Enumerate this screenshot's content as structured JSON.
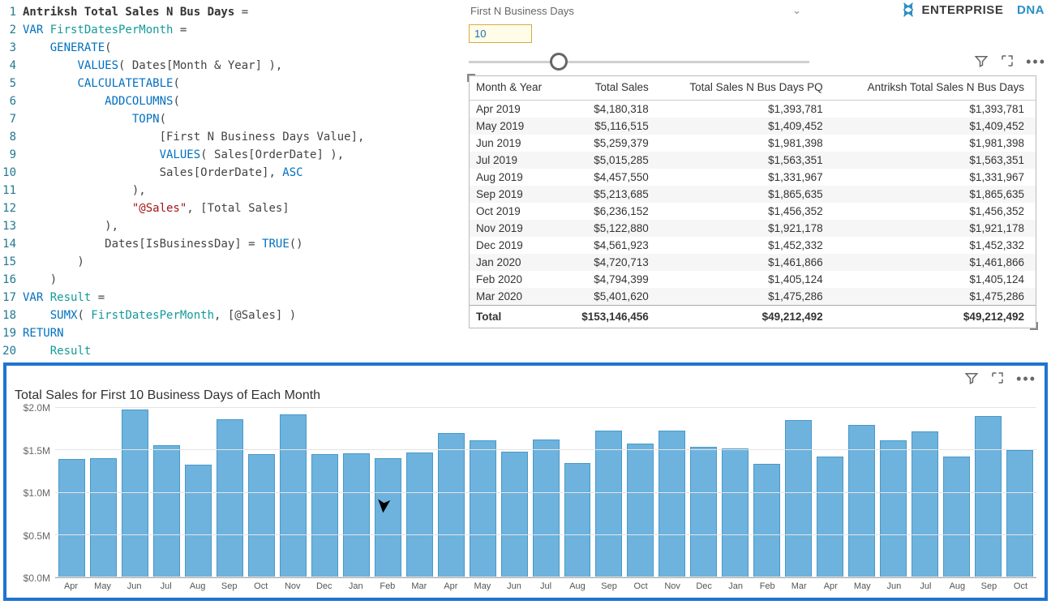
{
  "brand": {
    "text1": "ENTERPRISE",
    "text2": "DNA"
  },
  "slicer": {
    "label": "First N Business Days",
    "value": "10"
  },
  "code": {
    "lines": [
      [
        {
          "t": "measure",
          "v": "Antriksh Total Sales N Bus Days"
        },
        {
          "t": "op",
          "v": " = "
        }
      ],
      [
        {
          "t": "kw",
          "v": "VAR "
        },
        {
          "t": "teal",
          "v": "FirstDatesPerMonth"
        },
        {
          "t": "op",
          "v": " ="
        }
      ],
      [
        {
          "t": "op",
          "v": "    "
        },
        {
          "t": "func",
          "v": "GENERATE"
        },
        {
          "t": "op",
          "v": "("
        }
      ],
      [
        {
          "t": "op",
          "v": "        "
        },
        {
          "t": "func",
          "v": "VALUES"
        },
        {
          "t": "op",
          "v": "( "
        },
        {
          "t": "ref",
          "v": "Dates[Month & Year]"
        },
        {
          "t": "op",
          "v": " ),"
        }
      ],
      [
        {
          "t": "op",
          "v": "        "
        },
        {
          "t": "func",
          "v": "CALCULATETABLE"
        },
        {
          "t": "op",
          "v": "("
        }
      ],
      [
        {
          "t": "op",
          "v": "            "
        },
        {
          "t": "func",
          "v": "ADDCOLUMNS"
        },
        {
          "t": "op",
          "v": "("
        }
      ],
      [
        {
          "t": "op",
          "v": "                "
        },
        {
          "t": "func",
          "v": "TOPN"
        },
        {
          "t": "op",
          "v": "("
        }
      ],
      [
        {
          "t": "op",
          "v": "                    "
        },
        {
          "t": "ref",
          "v": "[First N Business Days Value]"
        },
        {
          "t": "op",
          "v": ","
        }
      ],
      [
        {
          "t": "op",
          "v": "                    "
        },
        {
          "t": "func",
          "v": "VALUES"
        },
        {
          "t": "op",
          "v": "( "
        },
        {
          "t": "ref",
          "v": "Sales[OrderDate]"
        },
        {
          "t": "op",
          "v": " ),"
        }
      ],
      [
        {
          "t": "op",
          "v": "                    "
        },
        {
          "t": "ref",
          "v": "Sales[OrderDate]"
        },
        {
          "t": "op",
          "v": ", "
        },
        {
          "t": "func",
          "v": "ASC"
        }
      ],
      [
        {
          "t": "op",
          "v": "                ),"
        }
      ],
      [
        {
          "t": "op",
          "v": "                "
        },
        {
          "t": "str",
          "v": "\"@Sales\""
        },
        {
          "t": "op",
          "v": ", "
        },
        {
          "t": "ref",
          "v": "[Total Sales]"
        }
      ],
      [
        {
          "t": "op",
          "v": "            ),"
        }
      ],
      [
        {
          "t": "op",
          "v": "            "
        },
        {
          "t": "ref",
          "v": "Dates[IsBusinessDay]"
        },
        {
          "t": "op",
          "v": " = "
        },
        {
          "t": "func",
          "v": "TRUE"
        },
        {
          "t": "op",
          "v": "()"
        }
      ],
      [
        {
          "t": "op",
          "v": "        )"
        }
      ],
      [
        {
          "t": "op",
          "v": "    )"
        }
      ],
      [
        {
          "t": "kw",
          "v": "VAR "
        },
        {
          "t": "teal",
          "v": "Result"
        },
        {
          "t": "op",
          "v": " ="
        }
      ],
      [
        {
          "t": "op",
          "v": "    "
        },
        {
          "t": "func",
          "v": "SUMX"
        },
        {
          "t": "op",
          "v": "( "
        },
        {
          "t": "teal",
          "v": "FirstDatesPerMonth"
        },
        {
          "t": "op",
          "v": ", "
        },
        {
          "t": "ref",
          "v": "[@Sales]"
        },
        {
          "t": "op",
          "v": " )"
        }
      ],
      [
        {
          "t": "kw",
          "v": "RETURN"
        }
      ],
      [
        {
          "t": "op",
          "v": "    "
        },
        {
          "t": "teal",
          "v": "Result"
        }
      ]
    ]
  },
  "table": {
    "headers": [
      "Month & Year",
      "Total Sales",
      "Total Sales N Bus Days PQ",
      "Antriksh Total Sales N Bus Days"
    ],
    "rows": [
      [
        "Apr 2019",
        "$4,180,318",
        "$1,393,781",
        "$1,393,781"
      ],
      [
        "May 2019",
        "$5,116,515",
        "$1,409,452",
        "$1,409,452"
      ],
      [
        "Jun 2019",
        "$5,259,379",
        "$1,981,398",
        "$1,981,398"
      ],
      [
        "Jul 2019",
        "$5,015,285",
        "$1,563,351",
        "$1,563,351"
      ],
      [
        "Aug 2019",
        "$4,457,550",
        "$1,331,967",
        "$1,331,967"
      ],
      [
        "Sep 2019",
        "$5,213,685",
        "$1,865,635",
        "$1,865,635"
      ],
      [
        "Oct 2019",
        "$6,236,152",
        "$1,456,352",
        "$1,456,352"
      ],
      [
        "Nov 2019",
        "$5,122,880",
        "$1,921,178",
        "$1,921,178"
      ],
      [
        "Dec 2019",
        "$4,561,923",
        "$1,452,332",
        "$1,452,332"
      ],
      [
        "Jan 2020",
        "$4,720,713",
        "$1,461,866",
        "$1,461,866"
      ],
      [
        "Feb 2020",
        "$4,794,399",
        "$1,405,124",
        "$1,405,124"
      ],
      [
        "Mar 2020",
        "$5,401,620",
        "$1,475,286",
        "$1,475,286"
      ]
    ],
    "total": [
      "Total",
      "$153,146,456",
      "$49,212,492",
      "$49,212,492"
    ]
  },
  "chart_data": {
    "type": "bar",
    "title": "Total Sales for First 10 Business Days of Each Month",
    "ylabel": "",
    "xlabel": "",
    "ylim": [
      0,
      2000000
    ],
    "y_ticks": [
      "$2.0M",
      "$1.5M",
      "$1.0M",
      "$0.5M",
      "$0.0M"
    ],
    "categories": [
      "Apr",
      "May",
      "Jun",
      "Jul",
      "Aug",
      "Sep",
      "Oct",
      "Nov",
      "Dec",
      "Jan",
      "Feb",
      "Mar",
      "Apr",
      "May",
      "Jun",
      "Jul",
      "Aug",
      "Sep",
      "Oct",
      "Nov",
      "Dec",
      "Jan",
      "Feb",
      "Mar",
      "Apr",
      "May",
      "Jun",
      "Jul",
      "Aug",
      "Sep",
      "Oct"
    ],
    "values": [
      1393781,
      1409452,
      1981398,
      1563351,
      1331967,
      1865635,
      1456352,
      1921178,
      1452332,
      1461866,
      1405124,
      1475286,
      1700000,
      1620000,
      1480000,
      1630000,
      1350000,
      1730000,
      1580000,
      1730000,
      1540000,
      1520000,
      1340000,
      1860000,
      1430000,
      1800000,
      1620000,
      1720000,
      1430000,
      1900000,
      1500000
    ]
  }
}
